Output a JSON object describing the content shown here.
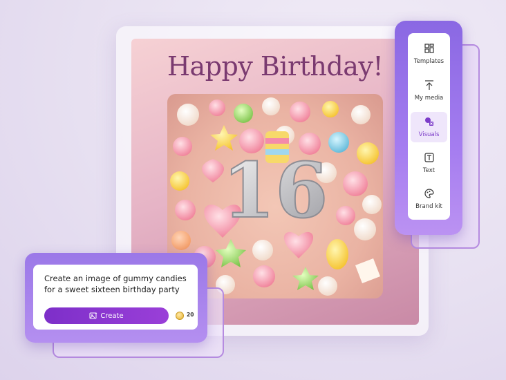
{
  "card": {
    "title": "Happy Birthday!",
    "photo_number": "16"
  },
  "toolbar": {
    "items": [
      {
        "label": "Templates",
        "icon": "templates-icon"
      },
      {
        "label": "My media",
        "icon": "upload-icon"
      },
      {
        "label": "Visuals",
        "icon": "visuals-icon",
        "active": true
      },
      {
        "label": "Text",
        "icon": "text-icon"
      },
      {
        "label": "Brand kit",
        "icon": "palette-icon"
      }
    ]
  },
  "prompt": {
    "text": "Create an image of gummy candies for a sweet sixteen birthday party",
    "button_label": "Create",
    "credits": "20"
  },
  "colors": {
    "accent": "#8a68e3",
    "button": "#7d2fc9",
    "title": "#7a3a70"
  }
}
